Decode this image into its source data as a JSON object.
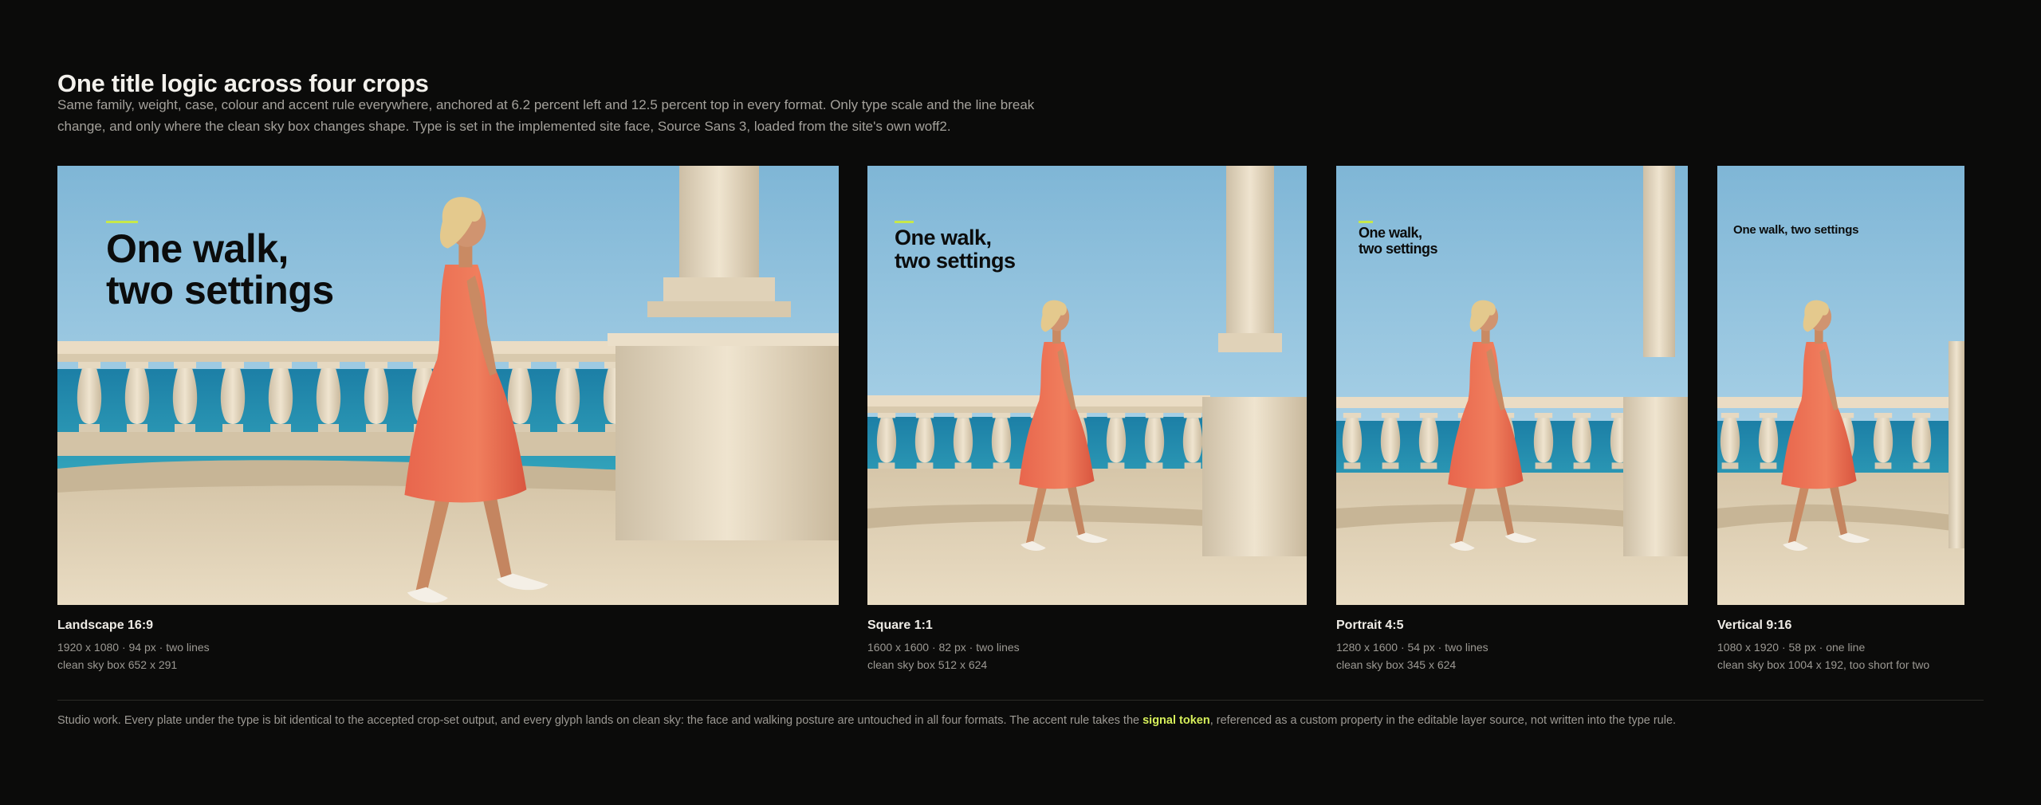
{
  "header": {
    "title": "One title logic across four crops",
    "subtitle": "Same family, weight, case, colour and accent rule everywhere, anchored at 6.2 percent left and 12.5 percent top in every format. Only type scale and the line break change, and only where the clean sky box changes shape. Type is set in the implemented site face, Source Sans 3, loaded from the site's own woff2."
  },
  "accent_color": "#c7e84a",
  "crops": [
    {
      "title_line1": "One walk,",
      "title_line2": "two settings",
      "name": "Landscape 16:9",
      "spec": "1920 x 1080 · 94 px · two lines",
      "box": "clean sky box 652 x 291"
    },
    {
      "title_line1": "One walk,",
      "title_line2": "two settings",
      "name": "Square 1:1",
      "spec": "1600 x 1600 · 82 px · two lines",
      "box": "clean sky box 512 x 624"
    },
    {
      "title_line1": "One walk,",
      "title_line2": "two settings",
      "name": "Portrait 4:5",
      "spec": "1280 x 1600 · 54 px · two lines",
      "box": "clean sky box 345 x 624"
    },
    {
      "title_line1": "One walk, two settings",
      "title_line2": "",
      "name": "Vertical 9:16",
      "spec": "1080 x 1920 · 58 px · one line",
      "box": "clean sky box 1004 x 192, too short for two"
    }
  ],
  "footer": {
    "before": "Studio work. Every plate under the type is bit identical to the accepted crop-set output, and every glyph lands on clean sky: the face and walking posture are untouched in all four formats. The accent rule takes the ",
    "signal": "signal token",
    "after": ", referenced as a custom property in the editable layer source, not written into the type rule."
  }
}
